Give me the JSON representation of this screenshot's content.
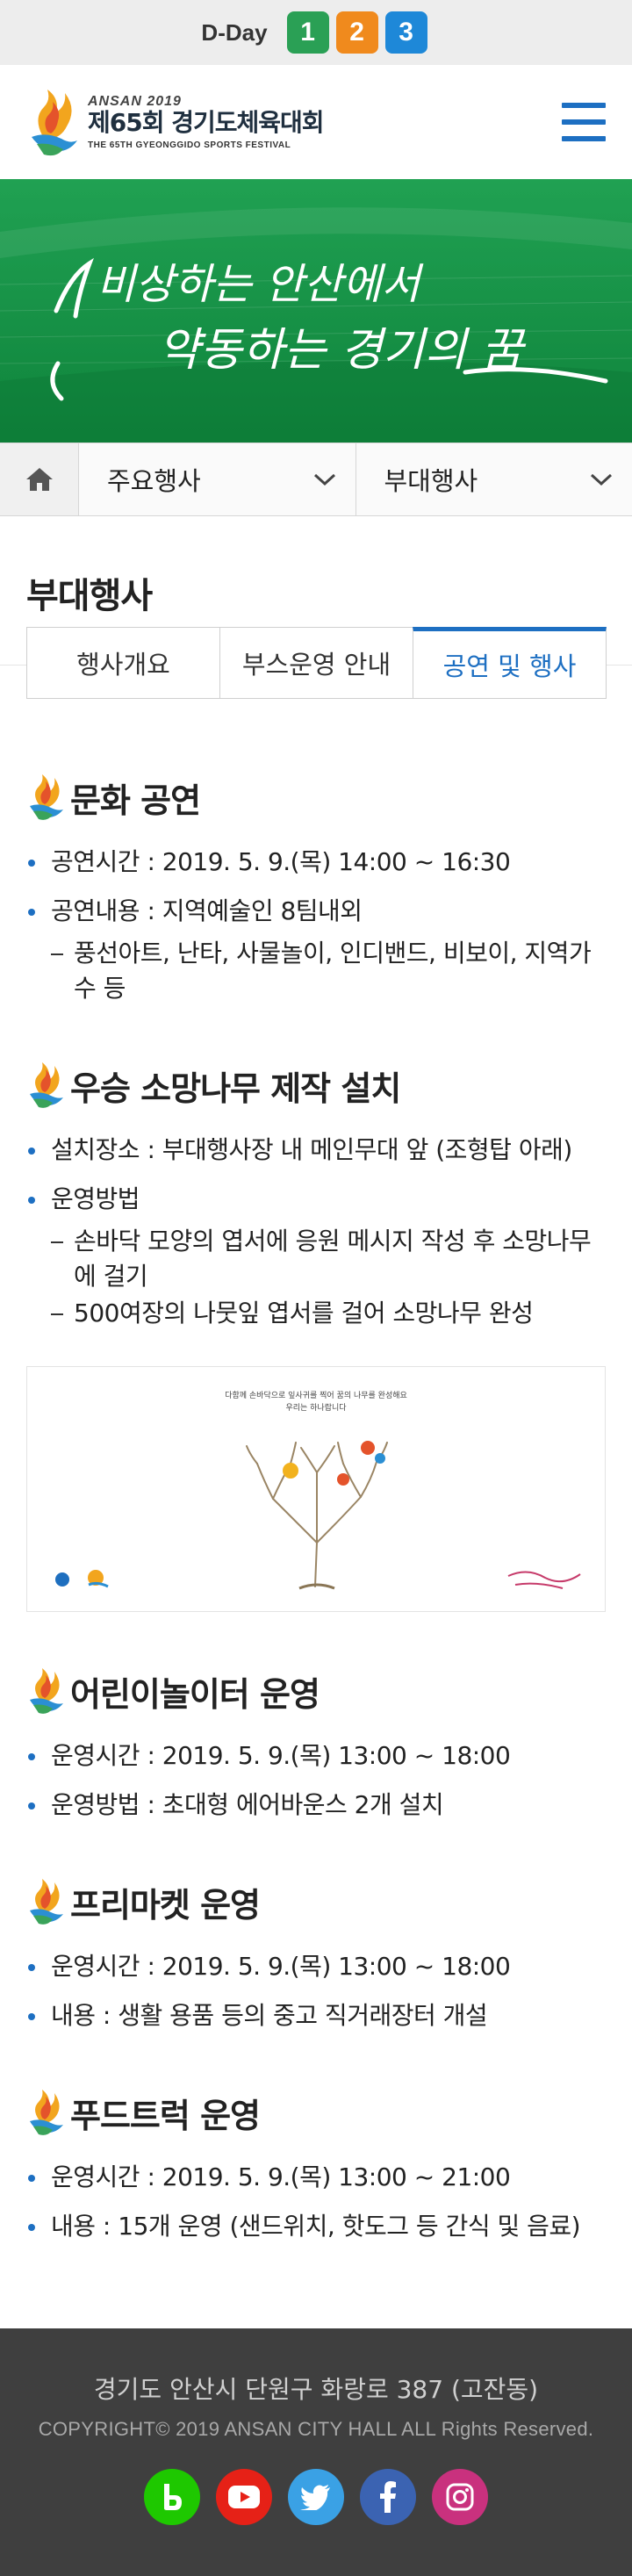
{
  "dday": {
    "label": "D-Day",
    "digits": [
      "1",
      "2",
      "3"
    ],
    "colors": [
      "#2aa055",
      "#f08a1d",
      "#1e88d8"
    ]
  },
  "header": {
    "logo_sub": "ANSAN 2019",
    "logo_title": "제65회 경기도체육대회",
    "logo_eng": "THE 65TH GYEONGGIDO SPORTS FESTIVAL",
    "menu_icon": "hamburger-menu-icon"
  },
  "banner": {
    "slogan_line1": "비상하는 안산에서",
    "slogan_line2": "약동하는 경기의 꿈",
    "bg_color": "#159145"
  },
  "subnav": {
    "home_icon": "home-icon",
    "select1": "주요행사",
    "select2": "부대행사"
  },
  "page": {
    "title": "부대행사"
  },
  "tabs": [
    {
      "label": "행사개요",
      "active": false
    },
    {
      "label": "부스운영 안내",
      "active": false
    },
    {
      "label": "공연 및 행사",
      "active": true
    }
  ],
  "sections": {
    "culture": {
      "title": "문화 공연",
      "b1": "공연시간 : 2019. 5. 9.(목) 14:00 ~ 16:30",
      "b2": "공연내용 : 지역예술인 8팀내외",
      "s1": "풍선아트, 난타, 사물놀이, 인디밴드, 비보이, 지역가수 등"
    },
    "wish": {
      "title": "우승 소망나무 제작 설치",
      "b1": "설치장소 : 부대행사장 내 메인무대 앞 (조형탑 아래)",
      "b2": "운영방법",
      "s1": "손바닥 모양의 엽서에 응원 메시지 작성 후 소망나무에 걸기",
      "s2": "500여장의 나뭇잎 엽서를 걸어 소망나무 완성",
      "card_caption1": "다함께 손바닥으로 잎사귀를 찍어 꿈의 나무를 완성해요",
      "card_caption2": "우리는 하나랍니다"
    },
    "kids": {
      "title": "어린이놀이터 운영",
      "b1": "운영시간 : 2019. 5. 9.(목) 13:00 ~ 18:00",
      "b2": "운영방법 : 초대형 에어바운스 2개 설치"
    },
    "flea": {
      "title": "프리마켓 운영",
      "b1": "운영시간 : 2019. 5. 9.(목) 13:00 ~ 18:00",
      "b2": "내용 : 생활 용품 등의 중고 직거래장터 개설"
    },
    "food": {
      "title": "푸드트럭 운영",
      "b1": "운영시간 : 2019. 5. 9.(목) 13:00 ~ 21:00",
      "b2": "내용 : 15개 운영 (샌드위치, 핫도그 등 간식 및 음료)"
    }
  },
  "footer": {
    "address": "경기도 안산시 단원구 화랑로 387 (고잔동)",
    "copyright": "COPYRIGHT© 2019 ANSAN CITY HALL ALL Rights Reserved.",
    "sns": [
      {
        "name": "band-icon",
        "color": "#1ec800"
      },
      {
        "name": "youtube-icon",
        "color": "#e62117"
      },
      {
        "name": "twitter-icon",
        "color": "#3aa1e5"
      },
      {
        "name": "facebook-icon",
        "color": "#3b63b2"
      },
      {
        "name": "instagram-icon",
        "color": "#c9317e"
      }
    ]
  }
}
